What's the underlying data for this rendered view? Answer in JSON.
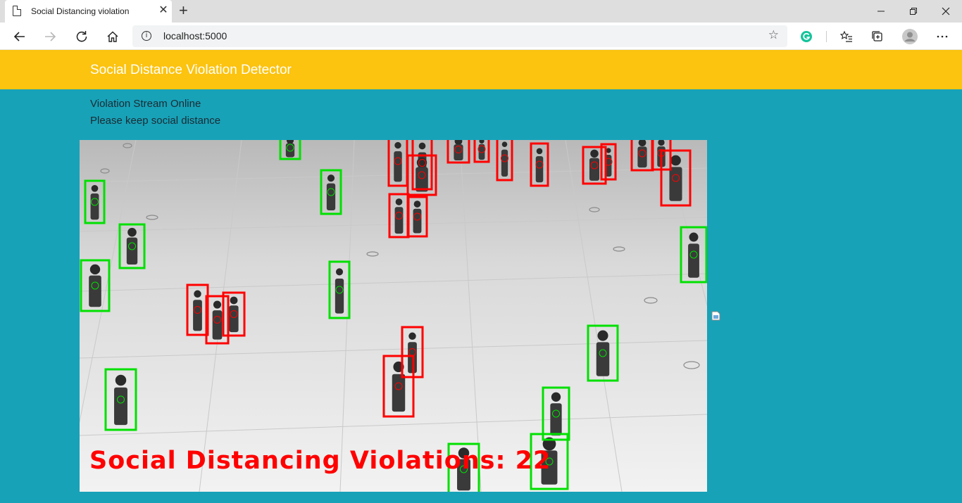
{
  "browser": {
    "tab_title": "Social Distancing violation",
    "tab_close": "✕",
    "new_tab": "+",
    "address": "localhost:5000",
    "info_icon": "i",
    "window_controls": {
      "minimize": "—",
      "restore": "❐",
      "close": "✕"
    }
  },
  "page": {
    "brand": "Social Distance Violation Detector",
    "status_line_1": "Violation Stream Online",
    "status_line_2": "Please keep social distance"
  },
  "stream": {
    "overlay_text": "Social Distancing Violations: 22",
    "violation_count": 22,
    "colors": {
      "violation": "#ff0000",
      "safe": "#00e000"
    }
  }
}
